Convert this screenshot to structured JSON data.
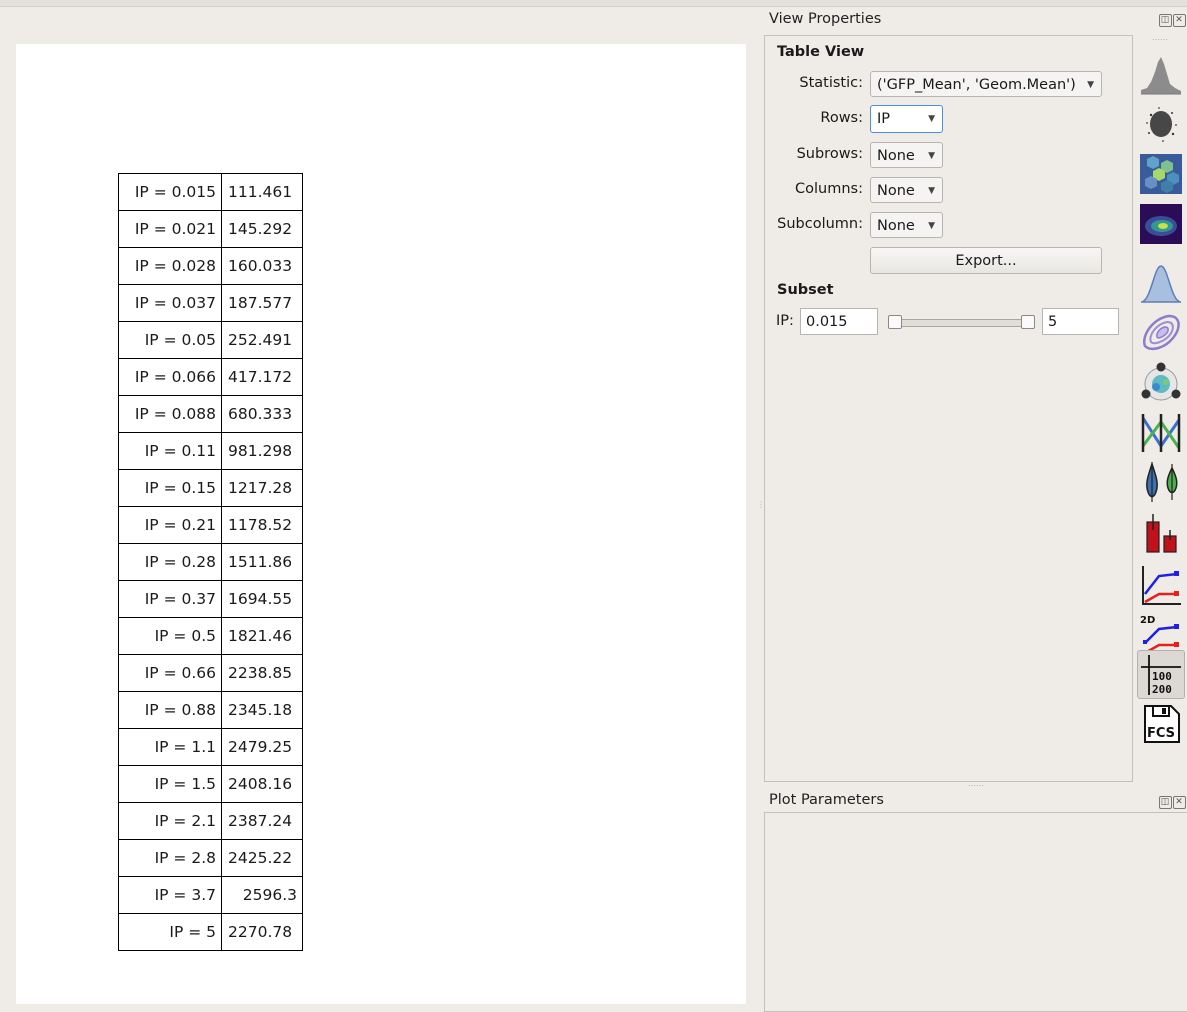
{
  "plot": {
    "table": [
      {
        "label": "IP = 0.015",
        "value": "111.461"
      },
      {
        "label": "IP = 0.021",
        "value": "145.292"
      },
      {
        "label": "IP = 0.028",
        "value": "160.033"
      },
      {
        "label": "IP = 0.037",
        "value": "187.577"
      },
      {
        "label": "IP = 0.05",
        "value": "252.491"
      },
      {
        "label": "IP = 0.066",
        "value": "417.172"
      },
      {
        "label": "IP = 0.088",
        "value": "680.333"
      },
      {
        "label": "IP = 0.11",
        "value": "981.298"
      },
      {
        "label": "IP = 0.15",
        "value": "1217.28"
      },
      {
        "label": "IP = 0.21",
        "value": "1178.52"
      },
      {
        "label": "IP = 0.28",
        "value": "1511.86"
      },
      {
        "label": "IP = 0.37",
        "value": "1694.55"
      },
      {
        "label": "IP = 0.5",
        "value": "1821.46"
      },
      {
        "label": "IP = 0.66",
        "value": "2238.85"
      },
      {
        "label": "IP = 0.88",
        "value": "2345.18"
      },
      {
        "label": "IP = 1.1",
        "value": "2479.25"
      },
      {
        "label": "IP = 1.5",
        "value": "2408.16"
      },
      {
        "label": "IP = 2.1",
        "value": "2387.24"
      },
      {
        "label": "IP = 2.8",
        "value": "2425.22"
      },
      {
        "label": "IP = 3.7",
        "value": "2596.3"
      },
      {
        "label": "IP = 5",
        "value": "2270.78"
      }
    ]
  },
  "view_properties": {
    "title": "View Properties",
    "table_view": {
      "heading": "Table View",
      "statistic_label": "Statistic:",
      "statistic_value": "('GFP_Mean', 'Geom.Mean')",
      "rows_label": "Rows:",
      "rows_value": "IP",
      "subrows_label": "Subrows:",
      "subrows_value": "None",
      "columns_label": "Columns:",
      "columns_value": "None",
      "subcolumn_label": "Subcolumn:",
      "subcolumn_value": "None",
      "export_label": "Export..."
    },
    "subset": {
      "heading": "Subset",
      "ip_label": "IP:",
      "ip_min": "0.015",
      "ip_max": "5"
    }
  },
  "toolbar": {
    "items": [
      {
        "icon": "histogram-icon"
      },
      {
        "icon": "scatterplot-icon"
      },
      {
        "icon": "hexbin-icon"
      },
      {
        "icon": "density-plot-icon"
      },
      {
        "icon": "kde-1d-icon"
      },
      {
        "icon": "kde-2d-icon"
      },
      {
        "icon": "radviz-icon"
      },
      {
        "icon": "parallel-coordinates-icon"
      },
      {
        "icon": "violin-plot-icon"
      },
      {
        "icon": "bar-chart-icon"
      },
      {
        "icon": "line-statistics-icon"
      },
      {
        "icon": "line-statistics-2d-icon"
      },
      {
        "icon": "table-view-icon",
        "text_top": "100",
        "text_bottom": "200",
        "active": true
      },
      {
        "icon": "fcs-export-icon",
        "text": "FCS"
      }
    ]
  },
  "plot_parameters": {
    "title": "Plot Parameters"
  },
  "colors": {
    "window_bg": "#efebe7",
    "plot_bg": "#ffffff",
    "focus_blue": "#4a90d9",
    "series_blue": "#1f1fe6",
    "series_red": "#e61f1f"
  }
}
